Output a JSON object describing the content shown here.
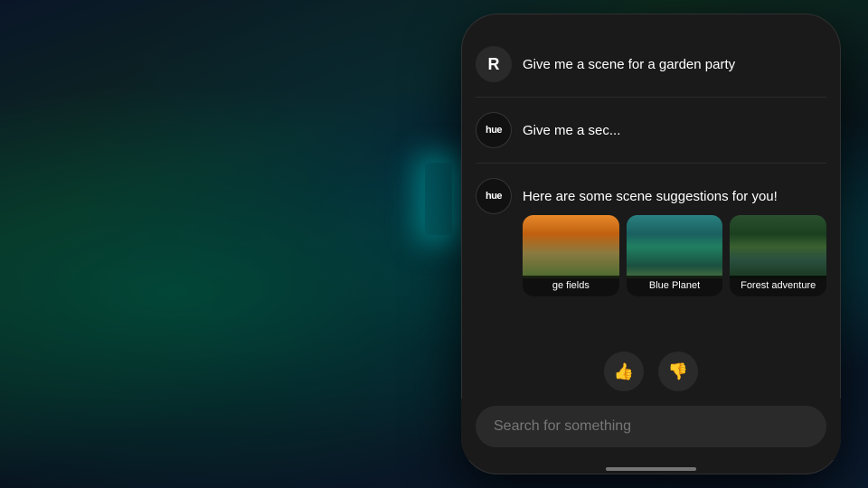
{
  "background": {
    "description": "Night garden scene"
  },
  "phone": {
    "messages": [
      {
        "id": "msg-1",
        "avatar_type": "user",
        "avatar_label": "R",
        "text": "Give me a scene for a garden party",
        "blurred": false
      },
      {
        "id": "msg-2",
        "avatar_type": "hue",
        "avatar_label": "hue",
        "text": "Give me a sec...",
        "blurred": true,
        "blurred_suffix": "          "
      },
      {
        "id": "msg-3",
        "avatar_type": "hue",
        "avatar_label": "hue",
        "scene_response": true,
        "label": "Here are some scene suggestions for you!",
        "scenes": [
          {
            "id": "scene-orange",
            "name": "Orange fields",
            "display_name": "ge fields",
            "type": "orange-fields"
          },
          {
            "id": "scene-blue",
            "name": "Blue Planet",
            "display_name": "Blue Planet",
            "type": "blue-planet"
          },
          {
            "id": "scene-forest",
            "name": "Forest adventure",
            "display_name": "Forest adventure",
            "type": "forest"
          }
        ]
      }
    ],
    "feedback": {
      "thumbs_up_label": "👍",
      "thumbs_down_label": "👎"
    },
    "search": {
      "placeholder": "Search for something"
    }
  }
}
